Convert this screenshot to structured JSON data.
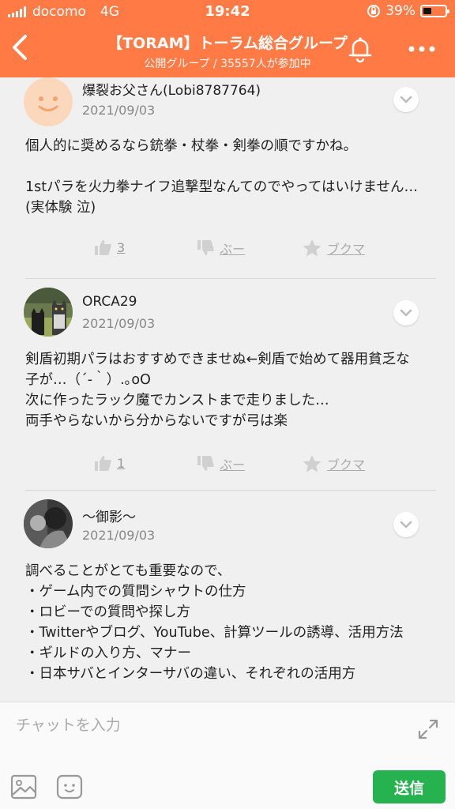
{
  "status": {
    "carrier": "docomo",
    "network": "4G",
    "time": "19:42",
    "battery": "39%",
    "battery_level": 0.39
  },
  "header": {
    "title": "【TORAM】トーラム総合グループ",
    "subtitle": "公開グループ / 35557人が参加中",
    "accent": "#ff7a45"
  },
  "posts": [
    {
      "user": "爆裂お父さん(Lobi8787764)",
      "date": "2021/09/03",
      "body": "個人的に奨めるなら銃拳・杖拳・剣拳の順ですかね。\n\n1stパラを火力拳ナイフ追撃型なんてのでやってはいけません…(実体験 泣)",
      "likes": "3",
      "boo": "ぶー",
      "bookmark": "ブクマ"
    },
    {
      "user": "ORCA29",
      "date": "2021/09/03",
      "body": "剣盾初期パラはおすすめできませぬ←剣盾で始めて器用貧乏な子が…（´-｀）.｡oO\n次に作ったラック魔でカンストまで走りました…\n両手やらないから分からないですが弓は楽",
      "likes": "1",
      "boo": "ぶー",
      "bookmark": "ブクマ"
    },
    {
      "user": "〜御影〜",
      "date": "2021/09/03",
      "body": "調べることがとても重要なので、\n・ゲーム内での質問シャウトの仕方\n・ロビーでの質問や探し方\n・Twitterやブログ、YouTube、計算ツールの誘導、活用方法\n・ギルドの入り方、マナー\n・日本サバとインターサバの違い、それぞれの活用方"
    }
  ],
  "composer": {
    "placeholder": "チャットを入力",
    "send_label": "送信",
    "send_color": "#26b24e"
  }
}
